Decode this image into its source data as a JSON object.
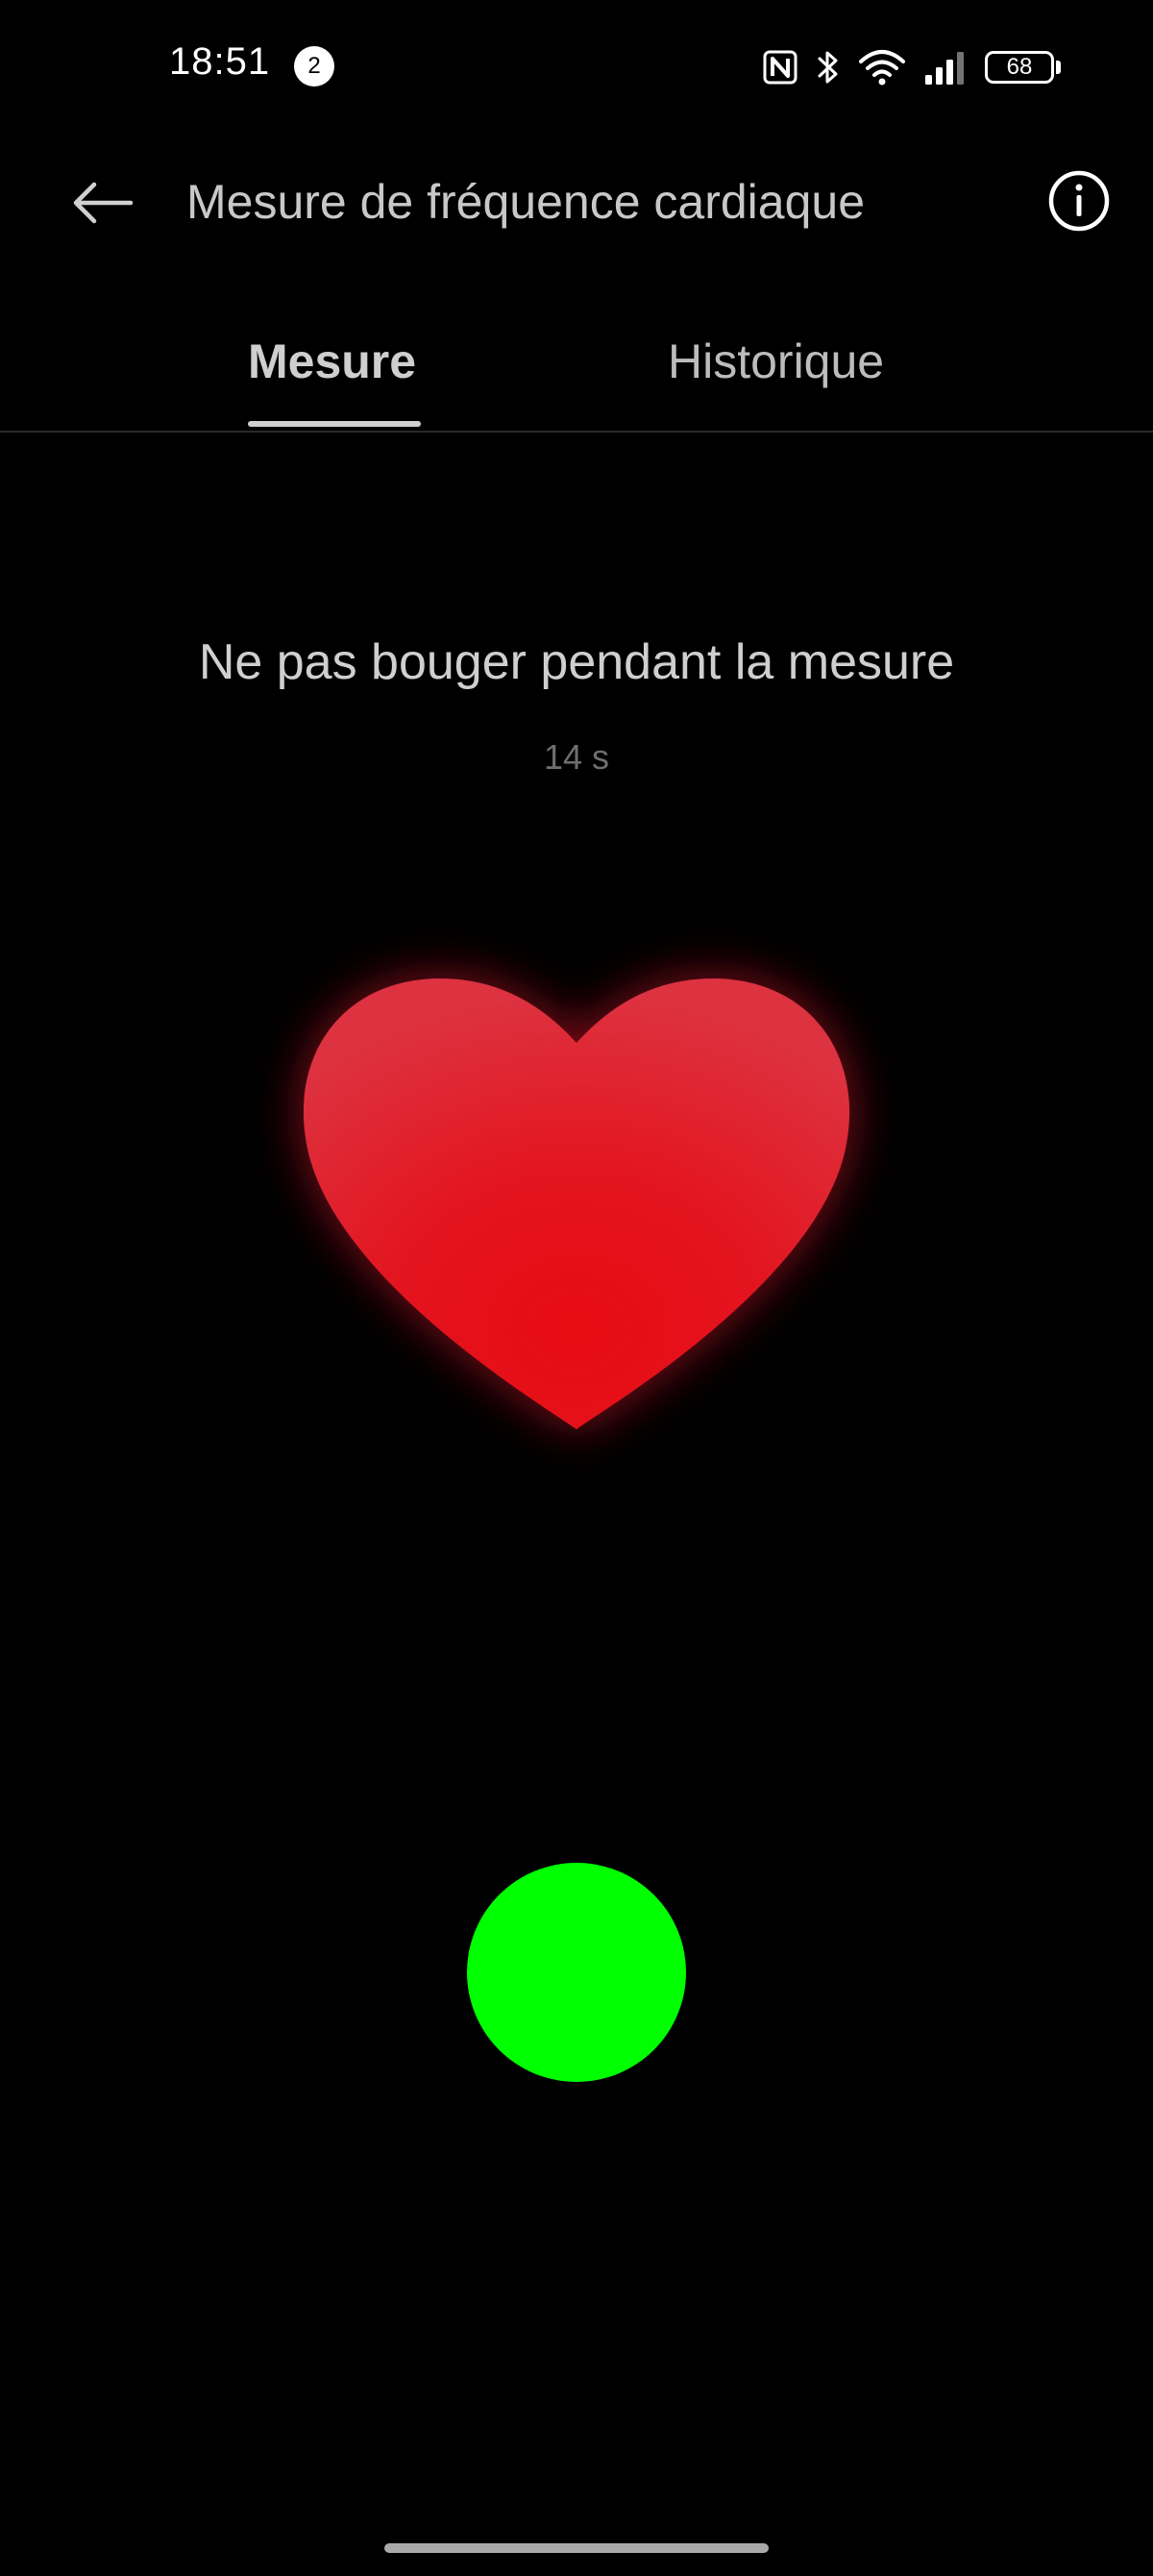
{
  "status_bar": {
    "time": "18:51",
    "notification_count": "2",
    "battery_level": "68",
    "icons": [
      "nfc-icon",
      "bluetooth-icon",
      "wifi-icon",
      "signal-icon",
      "battery-icon"
    ]
  },
  "header": {
    "back_icon": "arrow-left-icon",
    "title": "Mesure de fréquence cardiaque",
    "info_icon": "info-icon"
  },
  "tabs": [
    {
      "label": "Mesure",
      "active": true
    },
    {
      "label": "Historique",
      "active": false
    }
  ],
  "measurement": {
    "instruction": "Ne pas bouger pendant la mesure",
    "timer": "14 s",
    "heart_icon": "heart-icon",
    "indicator_color": "#00ff00"
  },
  "colors": {
    "background": "#000000",
    "heart_red": "#e0141e",
    "indicator_green": "#00ff00",
    "text_primary": "#cfcfcf",
    "text_secondary": "#6e6e6e"
  }
}
